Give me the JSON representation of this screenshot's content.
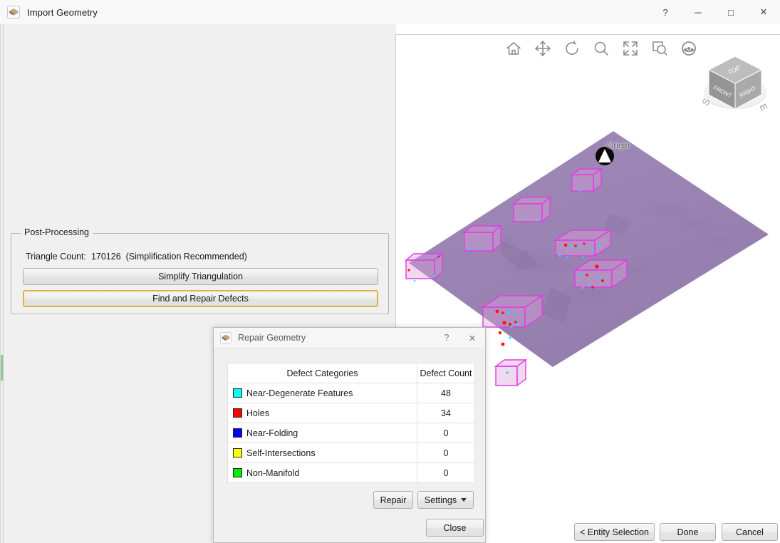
{
  "window": {
    "title": "Import Geometry",
    "app_icon": "geometry-import-icon",
    "controls": {
      "help": "?",
      "minimize": "─",
      "maximize": "□",
      "close": "✕"
    }
  },
  "left_panel": {
    "group": {
      "legend": "Post-Processing",
      "triangle_count_label": "Triangle Count:",
      "triangle_count_value": "170126",
      "triangle_count_note": "(Simplification Recommended)",
      "triangle_count_line": "Triangle Count:  170126  (Simplification Recommended)",
      "simplify_button": "Simplify Triangulation",
      "repair_button": "Find and Repair Defects"
    },
    "highlight_color": "#d9b441"
  },
  "viewport": {
    "background": "#ffffff",
    "toolbar": [
      {
        "name": "home-icon",
        "tooltip": "Home"
      },
      {
        "name": "pan-icon",
        "tooltip": "Pan"
      },
      {
        "name": "rotate-icon",
        "tooltip": "Rotate"
      },
      {
        "name": "zoom-icon",
        "tooltip": "Zoom"
      },
      {
        "name": "fit-to-window-icon",
        "tooltip": "Fit"
      },
      {
        "name": "zoom-to-box-icon",
        "tooltip": "Zoom Box"
      },
      {
        "name": "view-style-icon",
        "tooltip": "View Style"
      }
    ],
    "viewcube": {
      "top_face": "TOP",
      "front_face": "FRONT",
      "right_face": "RIGHT",
      "compass_south": "S",
      "compass_east": "E"
    },
    "origin_label": "Origin",
    "model_colors": {
      "terrain": "#9b84b4",
      "box_edges": "#e040e0",
      "box_fill": "#e6a8e6",
      "defect_red": "#ff0000",
      "defect_cyan": "#00e5ff"
    }
  },
  "footer": {
    "entity_selection": "< Entity Selection",
    "done": "Done",
    "cancel": "Cancel"
  },
  "repair_dialog": {
    "title": "Repair Geometry",
    "icon": "geometry-import-icon",
    "controls": {
      "help": "?",
      "close": "✕"
    },
    "table": {
      "headers": [
        "Defect Categories",
        "Defect Count"
      ],
      "rows": [
        {
          "color": "#00ffff",
          "label": "Near-Degenerate Features",
          "count": "48"
        },
        {
          "color": "#ff0000",
          "label": "Holes",
          "count": "34"
        },
        {
          "color": "#0000ff",
          "label": "Near-Folding",
          "count": "0"
        },
        {
          "color": "#ffff00",
          "label": "Self-Intersections",
          "count": "0"
        },
        {
          "color": "#00ee00",
          "label": "Non-Manifold",
          "count": "0"
        }
      ]
    },
    "buttons": {
      "repair": "Repair",
      "settings": "Settings",
      "close": "Close"
    }
  }
}
